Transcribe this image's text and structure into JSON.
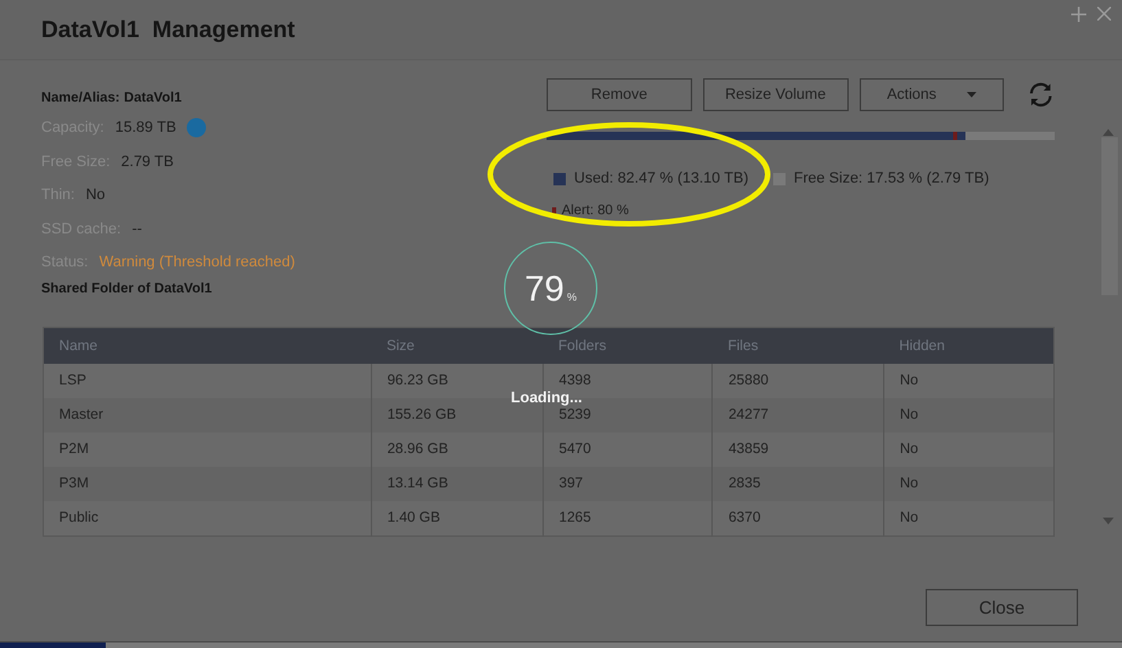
{
  "window": {
    "title": "DataVol1  Management"
  },
  "info": [
    {
      "kind": "bold",
      "label": "Name/Alias:",
      "value": "DataVol1"
    },
    {
      "kind": "plain",
      "label": "Capacity:",
      "value": "15.89 TB",
      "info_icon": true
    },
    {
      "kind": "plain",
      "label": "Free Size:",
      "value": "2.79 TB"
    },
    {
      "kind": "plain",
      "label": "Thin:",
      "value": "No"
    },
    {
      "kind": "plain",
      "label": "SSD cache:",
      "value": "--"
    },
    {
      "kind": "warning",
      "label": "Status:",
      "value": "Warning (Threshold reached)"
    }
  ],
  "section_title": "Shared Folder of DataVol1",
  "buttons": [
    {
      "label": "Remove",
      "dropdown": false
    },
    {
      "label": "Resize Volume",
      "dropdown": false
    },
    {
      "label": "Actions",
      "dropdown": true
    }
  ],
  "usage": {
    "level": 0.8247,
    "alert_marker": {
      "level": 0.8
    },
    "used": "Used: 82.47 % (13.10 TB)",
    "free": "Free Size: 17.53 % (2.79 TB)",
    "alert": "Alert: 80 %"
  },
  "table": {
    "columns": [
      "Name",
      "Size",
      "Folders",
      "Files",
      "Hidden"
    ],
    "rows": [
      [
        "LSP",
        "96.23 GB",
        "4398",
        "25880",
        "No"
      ],
      [
        "Master",
        "155.26 GB",
        "5239",
        "24277",
        "No"
      ],
      [
        "P2M",
        "28.96 GB",
        "5470",
        "43859",
        "No"
      ],
      [
        "P3M",
        "13.14 GB",
        "397",
        "2835",
        "No"
      ],
      [
        "Public",
        "1.40 GB",
        "1265",
        "6370",
        "No"
      ]
    ]
  },
  "loading": {
    "value": "79",
    "unit": "%",
    "text": "Loading..."
  },
  "close_button": "Close"
}
